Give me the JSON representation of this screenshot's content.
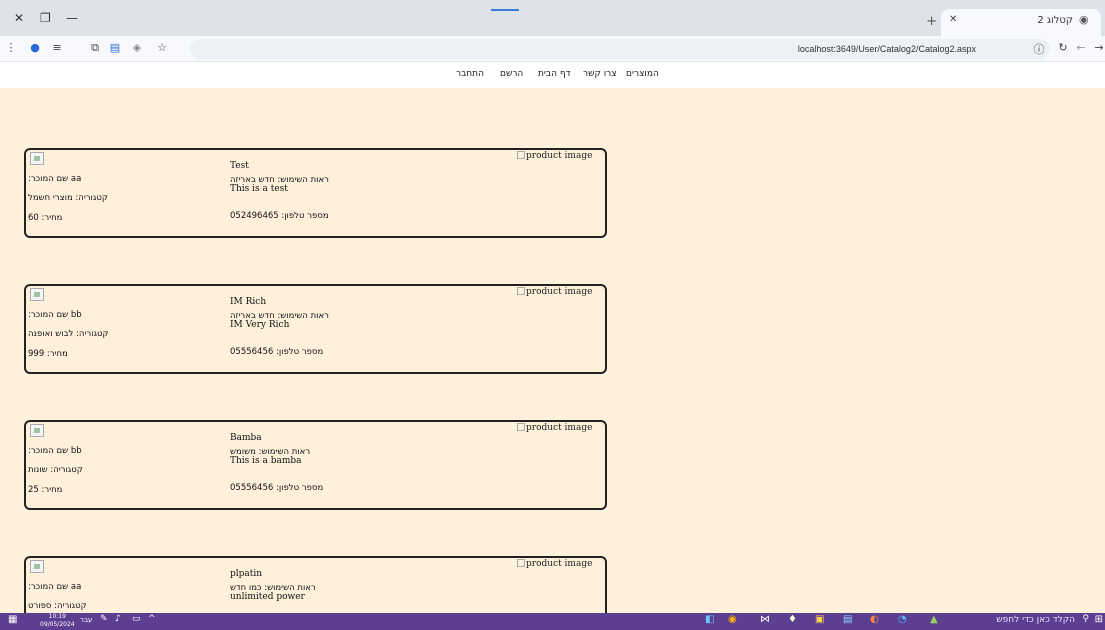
{
  "browser": {
    "tab_title": "קטלוג 2",
    "url": "localhost:3649/User/Catalog2/Catalog2.aspx",
    "controls": {
      "close": "✕",
      "restore": "❐",
      "minimize": "—"
    }
  },
  "nav": {
    "links": [
      "המוצרים",
      "צרו קשר",
      "דף הבית",
      "הרשם",
      "התחבר"
    ]
  },
  "products": [
    {
      "seller": ":שם המוכר aa",
      "category": "קטגוריה: מוצרי חשמל",
      "price": "מחיר: 60",
      "name": "Test",
      "usage": "ראות השימוש: חדש באריזה",
      "description": "This is a test",
      "phone": "מספר טלפון: 052496465",
      "img_alt": "product image"
    },
    {
      "seller": ":שם המוכר bb",
      "category": "קטגוריה: לבוש ואופנה",
      "price": "מחיר: 999",
      "name": "IM Rich",
      "usage": "ראות השימוש: חדש באריזה",
      "description": "IM Very Rich",
      "phone": "מספר טלפון: 05556456",
      "img_alt": "product image"
    },
    {
      "seller": ":שם המוכר bb",
      "category": "קטגוריה: שונות",
      "price": "מחיר: 25",
      "name": "Bamba",
      "usage": "ראות השימוש: משומש",
      "description": "This is a bamba",
      "phone": "מספר טלפון: 05556456",
      "img_alt": "product image"
    },
    {
      "seller": ":שם המוכר aa",
      "category": "קטגוריה: ספורט",
      "price": "",
      "name": "plpatin",
      "usage": "ראות השימוש: כמו חדש",
      "description": "unlimited power",
      "phone": "",
      "img_alt": "product image"
    }
  ],
  "taskbar": {
    "search_placeholder": "הקלד כאן כדי לחפש",
    "time": "10:19",
    "date": "09/05/2024",
    "lang": "עבר"
  }
}
